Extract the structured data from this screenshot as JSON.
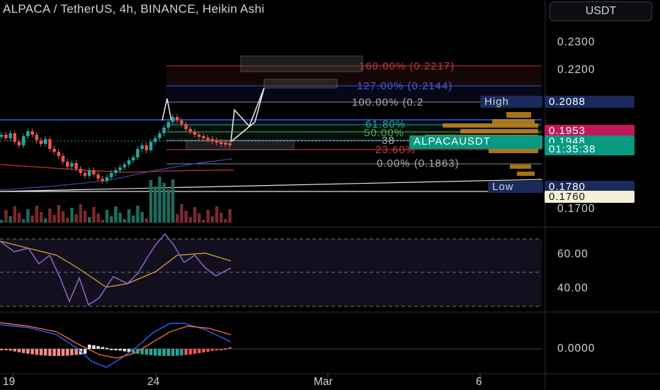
{
  "title": "ALPACA / TetherUS, 4h, BINANCE, Heikin Ashi",
  "currency_button": "USDT",
  "price_axis": [
    "0.2300",
    "0.2200",
    "0.1700"
  ],
  "price_tags": {
    "high_label": "High",
    "high_value": "0.2088",
    "prev_value": "0.1953",
    "symbol_label": "ALPACAUSDT",
    "symbol_value": "0.1948",
    "countdown": "01:35:38",
    "low_label": "Low",
    "low_value": "0.1780",
    "bottom_value": "0.1760"
  },
  "fib_levels": [
    {
      "text": "160.00% (0.2217)",
      "color": "#c0393b"
    },
    {
      "text": "127.00% (0.2144)",
      "color": "#3d4ed8"
    },
    {
      "text": "100.00% (0.2",
      "color": "#8a8d94"
    },
    {
      "text": "61.80%",
      "color": "#1fa99a"
    },
    {
      "text": "50.00%",
      "color": "#4caf50"
    },
    {
      "text": "38",
      "color": "#8a8d94"
    },
    {
      "text": "23.60%",
      "color": "#d23b3e"
    },
    {
      "text": "0.00% (0.1863)",
      "color": "#8a8d94"
    }
  ],
  "rsi_axis": [
    "60.00",
    "40.00"
  ],
  "macd_axis": [
    "0.0000"
  ],
  "time_axis": [
    "19",
    "24",
    "Mar",
    "6"
  ],
  "colors": {
    "up": "#26a69a",
    "down": "#ef5350",
    "blue": "#2962ff",
    "orange": "#f0a230"
  }
}
